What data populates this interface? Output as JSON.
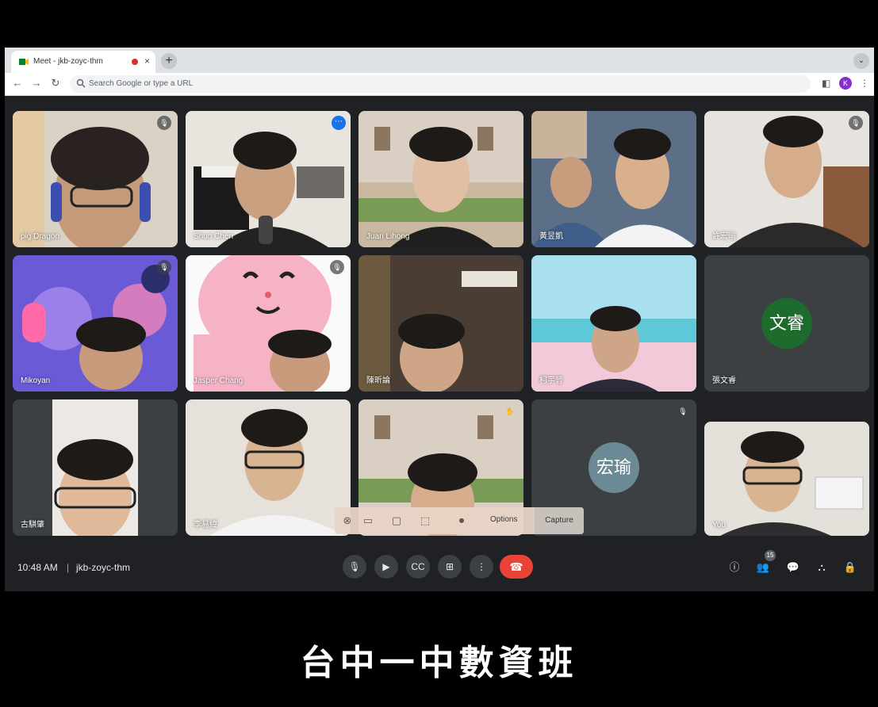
{
  "browser": {
    "tab_title": "Meet - jkb-zoyc-thm",
    "new_tab": "+",
    "omnibox_placeholder": "Search Google or type a URL",
    "profile_initial": "K"
  },
  "tiles": [
    {
      "name": "pig Dragon",
      "muted": true
    },
    {
      "name": "Shuo Chen",
      "active": true
    },
    {
      "name": "Juan Lihong"
    },
    {
      "name": "黃昱凱"
    },
    {
      "name": "許宏瑜",
      "muted": true
    },
    {
      "name": "Mikoyan",
      "muted": true
    },
    {
      "name": "Jasper Chang",
      "muted": true
    },
    {
      "name": "陳昕論"
    },
    {
      "name": "柯宇晉"
    },
    {
      "name": "張文睿",
      "avatar_text": "文睿",
      "avatar_color": "#1e6b2e"
    },
    {
      "name": "古騏肇"
    },
    {
      "name": "李易緯"
    },
    {
      "name": ""
    },
    {
      "name": "",
      "avatar_text": "宏瑜",
      "avatar_color": "#6b8a95",
      "muted": true
    },
    {
      "name": "You"
    }
  ],
  "capture_bar": {
    "options_label": "Options",
    "capture_label": "Capture"
  },
  "meet_bar": {
    "time": "10:48 AM",
    "separator": "|",
    "meeting_code": "jkb-zoyc-thm",
    "participant_count": "15"
  },
  "caption": "台中一中數資班",
  "colors": {
    "background": "#202124",
    "leave_red": "#ea4335",
    "active_blue": "#8ab4f8"
  }
}
